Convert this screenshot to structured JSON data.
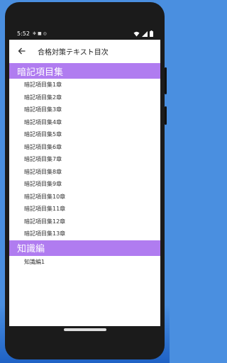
{
  "status_bar": {
    "time": "5:52",
    "icons_left": [
      "settings-icon",
      "lock-icon",
      "record-icon"
    ],
    "icons_right": [
      "wifi-icon",
      "signal-icon",
      "battery-icon"
    ]
  },
  "app_bar": {
    "title": "合格対策テキスト目次"
  },
  "sections": [
    {
      "title": "暗記項目集",
      "items": [
        "暗記項目集1章",
        "暗記項目集2章",
        "暗記項目集3章",
        "暗記項目集4章",
        "暗記項目集5章",
        "暗記項目集6章",
        "暗記項目集7章",
        "暗記項目集8章",
        "暗記項目集9章",
        "暗記項目集10章",
        "暗記項目集11章",
        "暗記項目集12章",
        "暗記項目集13章"
      ]
    },
    {
      "title": "知識編",
      "items": [
        "知識編1"
      ]
    }
  ],
  "colors": {
    "section_header": "#b07cf0",
    "background": "#4a8fe0"
  }
}
